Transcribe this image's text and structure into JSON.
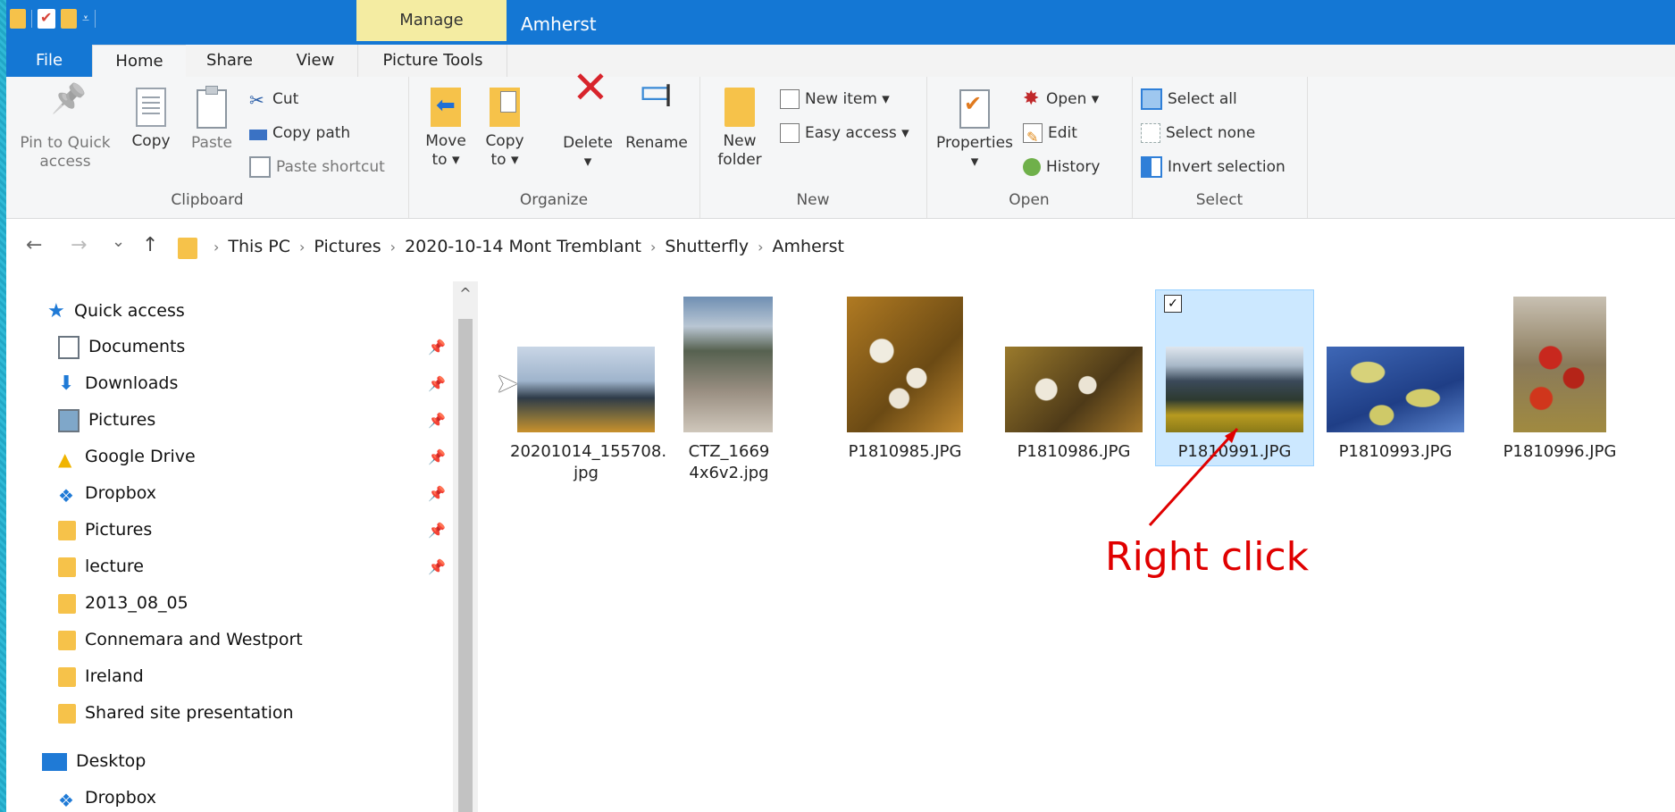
{
  "titlebar": {
    "manage_tab": "Manage",
    "title": "Amherst"
  },
  "tabs": [
    {
      "label": "File"
    },
    {
      "label": "Home"
    },
    {
      "label": "Share"
    },
    {
      "label": "View"
    },
    {
      "label": "Picture Tools"
    }
  ],
  "ribbon": {
    "clipboard": {
      "label": "Clipboard",
      "pin_line1": "Pin to Quick",
      "pin_line2": "access",
      "copy": "Copy",
      "paste": "Paste",
      "cut": "Cut",
      "copy_path": "Copy path",
      "paste_shortcut": "Paste shortcut"
    },
    "organize": {
      "label": "Organize",
      "move_line1": "Move",
      "move_line2": "to ▾",
      "copy_line1": "Copy",
      "copy_line2": "to ▾",
      "delete": "Delete",
      "delete_arrow": "▾",
      "rename": "Rename"
    },
    "new": {
      "label": "New",
      "folder_line1": "New",
      "folder_line2": "folder",
      "new_item": "New item ▾",
      "easy_access": "Easy access ▾"
    },
    "open": {
      "label": "Open",
      "properties": "Properties",
      "properties_arrow": "▾",
      "open": "Open ▾",
      "edit": "Edit",
      "history": "History"
    },
    "select": {
      "label": "Select",
      "select_all": "Select all",
      "select_none": "Select none",
      "invert": "Invert selection"
    }
  },
  "nav": {
    "back": "←",
    "forward": "→",
    "recent": "⌄",
    "up": "↑",
    "breadcrumb": [
      "This PC",
      "Pictures",
      "2020-10-14 Mont Tremblant",
      "Shutterfly",
      "Amherst"
    ],
    "separator": "›",
    "root_separator": "›"
  },
  "navpane": {
    "quick_access": "Quick access",
    "items": [
      {
        "label": "Documents",
        "pinned": true
      },
      {
        "label": "Downloads",
        "pinned": true
      },
      {
        "label": "Pictures",
        "pinned": true
      },
      {
        "label": "Google Drive",
        "pinned": true
      },
      {
        "label": "Dropbox",
        "pinned": true
      },
      {
        "label": "Pictures",
        "pinned": true
      },
      {
        "label": "lecture",
        "pinned": true
      },
      {
        "label": "2013_08_05",
        "pinned": false
      },
      {
        "label": "Connemara and Westport",
        "pinned": false
      },
      {
        "label": "Ireland",
        "pinned": false
      },
      {
        "label": "Shared site presentation",
        "pinned": false
      }
    ],
    "desktop": "Desktop",
    "dropbox": "Dropbox",
    "pin_glyph": "📌",
    "scroll_up": "^"
  },
  "files": [
    {
      "line1": "20201014_155708.",
      "line2": "jpg"
    },
    {
      "line1": "CTZ_1669",
      "line2": "4x6v2.jpg"
    },
    {
      "line1": "P1810985.JPG",
      "line2": ""
    },
    {
      "line1": "P1810986.JPG",
      "line2": ""
    },
    {
      "line1": "P1810991.JPG",
      "line2": "",
      "selected": true
    },
    {
      "line1": "P1810993.JPG",
      "line2": ""
    },
    {
      "line1": "P1810996.JPG",
      "line2": ""
    }
  ],
  "annotation": {
    "text": "Right click",
    "color": "#e00000"
  },
  "colors": {
    "accent": "#1477d4",
    "manage_tab": "#f4eca2",
    "selection": "#cce8ff",
    "folder": "#f6c24a"
  }
}
